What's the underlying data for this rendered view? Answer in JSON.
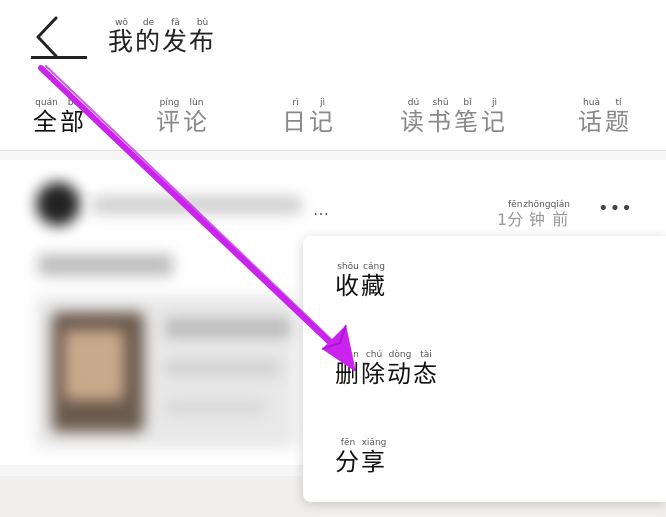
{
  "header": {
    "title": [
      {
        "char": "我",
        "pinyin": "wǒ"
      },
      {
        "char": "的",
        "pinyin": "de"
      },
      {
        "char": "发",
        "pinyin": "fā"
      },
      {
        "char": "布",
        "pinyin": "bù"
      }
    ]
  },
  "tabs": [
    {
      "chars": [
        {
          "char": "全",
          "pinyin": "quán"
        },
        {
          "char": "部",
          "pinyin": "bù"
        }
      ],
      "active": true
    },
    {
      "chars": [
        {
          "char": "评",
          "pinyin": "píng"
        },
        {
          "char": "论",
          "pinyin": "lùn"
        }
      ],
      "active": false
    },
    {
      "chars": [
        {
          "char": "日",
          "pinyin": "rì"
        },
        {
          "char": "记",
          "pinyin": "jì"
        }
      ],
      "active": false
    },
    {
      "chars": [
        {
          "char": "读",
          "pinyin": "dú"
        },
        {
          "char": "书",
          "pinyin": "shū"
        },
        {
          "char": "笔",
          "pinyin": "bǐ"
        },
        {
          "char": "记",
          "pinyin": "jì"
        }
      ],
      "active": false
    },
    {
      "chars": [
        {
          "char": "话",
          "pinyin": "huà"
        },
        {
          "char": "题",
          "pinyin": "tí"
        }
      ],
      "active": false
    }
  ],
  "post": {
    "ellipsis": "…",
    "timestamp": [
      {
        "char": "1",
        "pinyin": ""
      },
      {
        "char": "分",
        "pinyin": "fēn"
      },
      {
        "char": "钟",
        "pinyin": "zhōng"
      },
      {
        "char": "前",
        "pinyin": "qián"
      }
    ],
    "more_label": "•••"
  },
  "menu": {
    "items": [
      {
        "chars": [
          {
            "char": "收",
            "pinyin": "shōu"
          },
          {
            "char": "藏",
            "pinyin": "cáng"
          }
        ]
      },
      {
        "chars": [
          {
            "char": "删",
            "pinyin": "shān"
          },
          {
            "char": "除",
            "pinyin": "chú"
          },
          {
            "char": "动",
            "pinyin": "dòng"
          },
          {
            "char": "态",
            "pinyin": "tài"
          }
        ]
      },
      {
        "chars": [
          {
            "char": "分",
            "pinyin": "fēn"
          },
          {
            "char": "享",
            "pinyin": "xiǎng"
          }
        ]
      }
    ]
  },
  "colors": {
    "accent_arrow": "#cc22ee",
    "text": "#111111",
    "muted": "#888888"
  },
  "icons": {
    "back": "chevron-left-icon",
    "more": "more-horizontal-icon"
  }
}
